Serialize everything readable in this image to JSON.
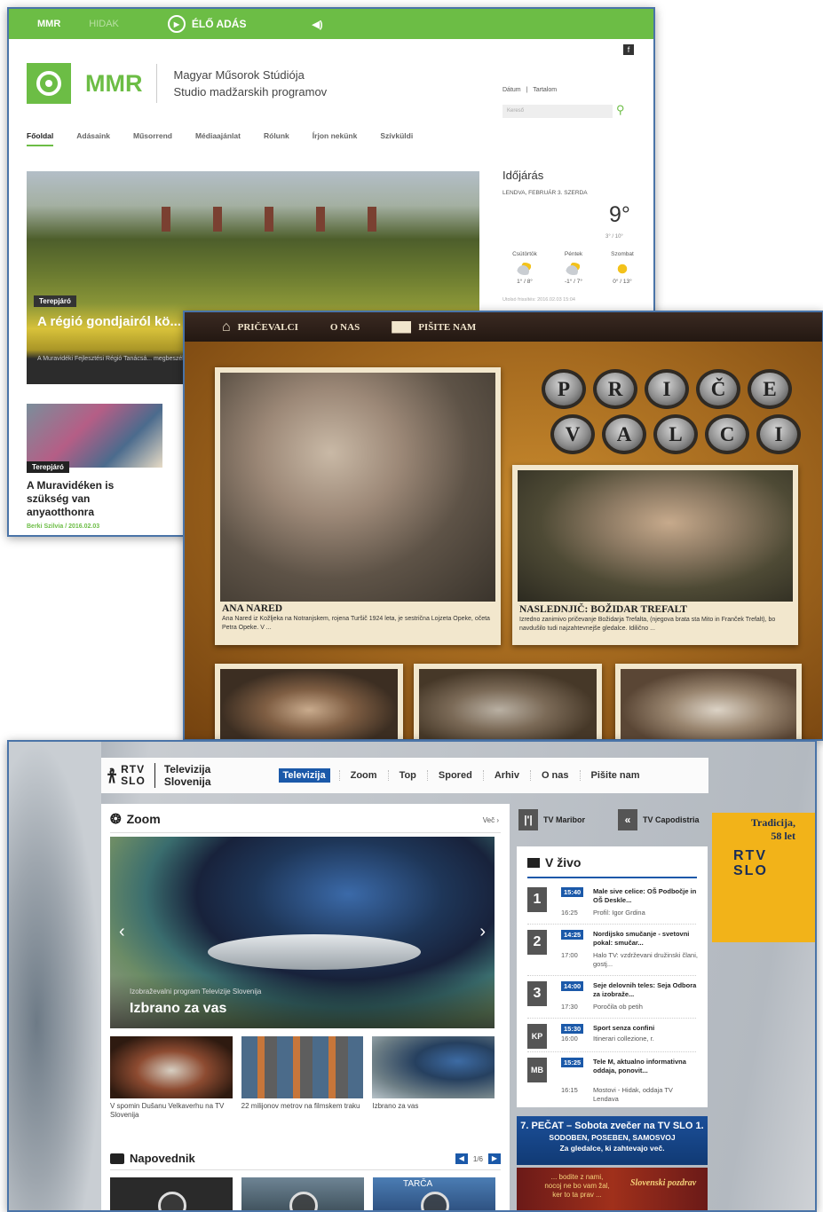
{
  "mmr": {
    "topbar": {
      "tab_mmr": "MMR",
      "tab_hidak": "HIDAK",
      "live": "ÉLŐ ADÁS",
      "speaker": "◀)"
    },
    "fb": "f",
    "logo": {
      "brand": "MMR",
      "line1": "Magyar Műsorok Stúdiója",
      "line2": "Studio madžarskih programov"
    },
    "util": {
      "datum": "Dátum",
      "tartalom": "Tartalom"
    },
    "search": {
      "placeholder": "Kereső"
    },
    "nav": [
      "Főoldal",
      "Adásaink",
      "Műsorrend",
      "Médiaajánlat",
      "Rólunk",
      "Írjon nekünk",
      "Szívküldi"
    ],
    "hero": {
      "tag": "Terepjáró",
      "title": "A régió gondjairól kö... polgármesterek és p...",
      "text": "A Muravidéki Fejlesztési Régió Tanácsá... megbeszélést tartottak a muravidéki kö..."
    },
    "card": {
      "tag": "Terepjáró",
      "title": "A Muravidéken is szükség van anyaotthonra",
      "byline": "Berki Szilvia / 2016.02.03"
    },
    "weather": {
      "title": "Időjárás",
      "location": "LENDVA, FEBRUÁR 3. SZERDA",
      "temp": "9°",
      "range": "3° / 10°",
      "days": [
        {
          "name": "Csütörtök",
          "temp": "1° / 8°",
          "icon": "cloud-sun-icon"
        },
        {
          "name": "Péntek",
          "temp": "-1° / 7°",
          "icon": "cloud-sun-icon"
        },
        {
          "name": "Szombat",
          "temp": "0° / 13°",
          "icon": "sun-icon"
        }
      ],
      "updated": "Utolsó frissítés: 2016.02.03 15:04"
    }
  },
  "pricevalci": {
    "nav": [
      "PRIČEVALCI",
      "O NAS",
      "PIŠITE NAM"
    ],
    "keys_row1": [
      "P",
      "R",
      "I",
      "Č",
      "E"
    ],
    "keys_row2": [
      "V",
      "A",
      "L",
      "C",
      "I"
    ],
    "card1": {
      "name": "ANA NARED",
      "desc": "Ana Nared iz Kožljeka na Notranjskem, rojena Turšič 1924 leta, je sestrična Lojzeta Opeke, očeta Petra Opeke. V ..."
    },
    "card2": {
      "name": "NASLEDNJIČ: BOŽIDAR TREFALT",
      "desc": "Izredno zanimivo pričevanje Božidarja Trefalta, (njegova brata sta Mito in Franček Trefalt), bo navdušilo tudi najzahtevnejše gledalce. Idilično ..."
    }
  },
  "rtv": {
    "brand": {
      "rtv": "RTV",
      "slo": "SLO",
      "line1": "Televizija",
      "line2": "Slovenija"
    },
    "menu": [
      "Televizija",
      "Zoom",
      "Top",
      "Spored",
      "Arhiv",
      "O nas",
      "Pišite nam"
    ],
    "zoom": {
      "title": "Zoom",
      "more": "Več ›"
    },
    "player": {
      "kicker": "Izobraževalni program Televizije Slovenija",
      "title": "Izbrano za vas"
    },
    "tiles": [
      "V spomin Dušanu Velkaverhu na TV Slovenija",
      "22 milijonov metrov na filmskem traku",
      "Izbrano za vas"
    ],
    "napovednik": {
      "title": "Napovednik",
      "pager": "1/6",
      "tile3_label": "TARČA"
    },
    "channels": [
      {
        "label": "TV Maribor",
        "icon": "mb-logo-icon"
      },
      {
        "label": "TV Capodistria",
        "icon": "kp-logo-icon"
      }
    ],
    "promo": {
      "text": "Tradicija, 58 let",
      "logo1": "RTV",
      "logo2": "SLO"
    },
    "live": {
      "title": "V živo",
      "rows": [
        {
          "ch": "1",
          "t1": "15:40",
          "title": "Male sive celice: OŠ Podbočje in OŠ Deskle...",
          "t2": "16:25",
          "next": "Profil: Igor Grdina"
        },
        {
          "ch": "2",
          "t1": "14:25",
          "title": "Nordijsko smučanje - svetovni pokal: smučar...",
          "t2": "17:00",
          "next": "Halo TV: vzdrževani družinski člani, gostj..."
        },
        {
          "ch": "3",
          "t1": "14:00",
          "title": "Seje delovnih teles: Seja Odbora za izobraže...",
          "t2": "17:30",
          "next": "Poročila ob petih"
        },
        {
          "ch": "KP",
          "t1": "15:30",
          "title": "Sport senza confini",
          "t2": "16:00",
          "next": "Itinerari collezione, r."
        },
        {
          "ch": "MB",
          "t1": "15:25",
          "title": "Tele M, aktualno informativna oddaja, ponovit...",
          "t2": "16:15",
          "next": "Mostovi - Hidak, oddaja TV Lendava"
        }
      ]
    },
    "pecat": {
      "a": "7. PEČAT – Sobota zvečer na TV SLO 1.",
      "b1": "SODOBEN, POSEBEN, SAMOSVOJ",
      "b2": "Za gledalce, ki zahtevajo več."
    },
    "slovenski": {
      "text1": "... bodite z nami,",
      "text2": "nocoj ne bo vam žal,",
      "text3": "ker to ta prav ...",
      "logo": "Slovenski pozdrav"
    }
  }
}
